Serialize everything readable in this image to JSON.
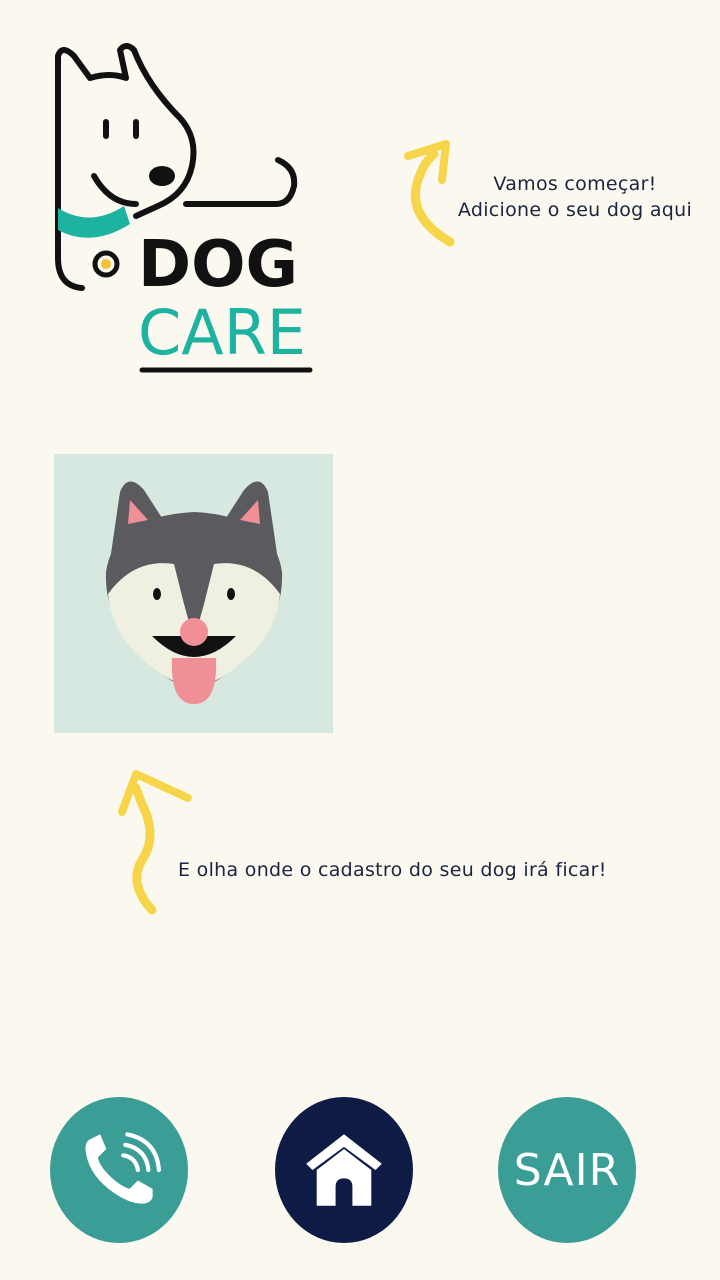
{
  "logo": {
    "line1": "DOG",
    "line2": "CARE",
    "colors": {
      "outline": "#111111",
      "teal": "#1db3a0",
      "accent": "#f4c230"
    }
  },
  "hints": {
    "top_line1": "Vamos começar!",
    "top_line2": "Adicione o seu dog aqui",
    "bottom": "E olha onde o cadastro do seu dog irá ficar!"
  },
  "dog_card": {
    "icon": "husky-face-icon",
    "background": "#d6e8df"
  },
  "nav": {
    "phone_icon": "phone-call-icon",
    "home_icon": "dog-house-icon",
    "exit_label": "SAIR"
  },
  "colors": {
    "background": "#fbf8ef",
    "teal": "#3a9e97",
    "navy": "#0d1b45",
    "arrow": "#f7d54a",
    "text": "#1b2440"
  }
}
